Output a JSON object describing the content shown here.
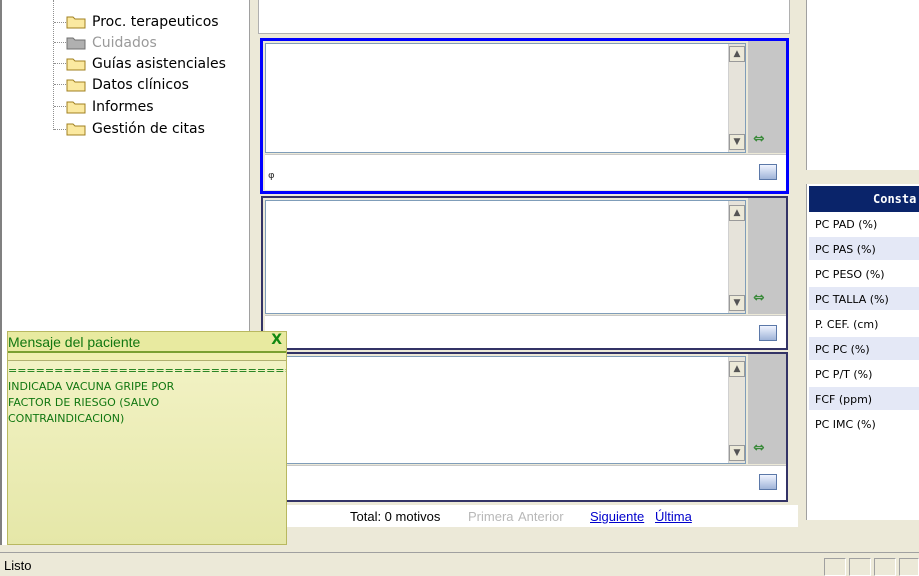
{
  "tree": {
    "items": [
      {
        "label": "Proc. terapeuticos",
        "disabled": false
      },
      {
        "label": "Cuidados",
        "disabled": true
      },
      {
        "label": "Guías asistenciales",
        "disabled": false
      },
      {
        "label": "Datos clínicos",
        "disabled": false
      },
      {
        "label": "Informes",
        "disabled": false
      },
      {
        "label": "Gestión de citas",
        "disabled": false
      }
    ]
  },
  "panes": [
    {
      "text": "",
      "focused": true
    },
    {
      "text": "",
      "focused": false
    },
    {
      "text": "",
      "focused": false
    }
  ],
  "pager": {
    "total": "Total: 0 motivos",
    "first": "Primera",
    "previous": "Anterior",
    "next": "Siguiente",
    "last": "Última"
  },
  "constants": {
    "header": "Consta",
    "rows": [
      "PC PAD (%)",
      "PC PAS (%)",
      "PC PESO (%)",
      "PC TALLA (%)",
      "P. CEF. (cm)",
      "PC PC (%)",
      "PC P/T (%)",
      "FCF (ppm)",
      "PC IMC (%)"
    ]
  },
  "message": {
    "title": "Mensaje del paciente",
    "close": "X",
    "separator": "==================================",
    "lines": [
      "INDICADA VACUNA GRIPE POR",
      "FACTOR DE RIESGO (SALVO",
      "CONTRAINDICACION)"
    ]
  },
  "status": {
    "text": "Listo"
  },
  "colors": {
    "focus_border": "#0000ff",
    "pane_border": "#333366",
    "header_bg": "#0a246a",
    "message_text": "#117711"
  }
}
